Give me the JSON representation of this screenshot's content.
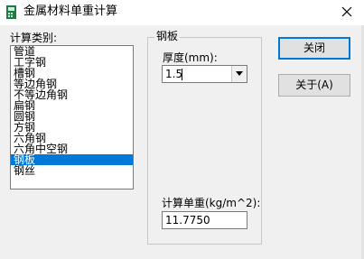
{
  "window": {
    "title": "金属材料单重计算",
    "icon": "app-icon",
    "close_icon": "close-icon"
  },
  "list": {
    "label": "计算类别:",
    "items": [
      "管道",
      "工字钢",
      "槽钢",
      "等边角钢",
      "不等边角钢",
      "扁钢",
      "圆钢",
      "方钢",
      "六角钢",
      "六角中空钢",
      "钢板",
      "钢丝"
    ],
    "selected": "钢板"
  },
  "group": {
    "title": "钢板",
    "thickness_label": "厚度(mm):",
    "thickness_value": "1.5",
    "unit_weight_label": "计算单重(kg/m^2):",
    "unit_weight_value": "11.7750"
  },
  "buttons": {
    "close": "关闭",
    "about": "关于(A)"
  },
  "colors": {
    "selection": "#0078d7",
    "face": "#f0f0f0"
  }
}
